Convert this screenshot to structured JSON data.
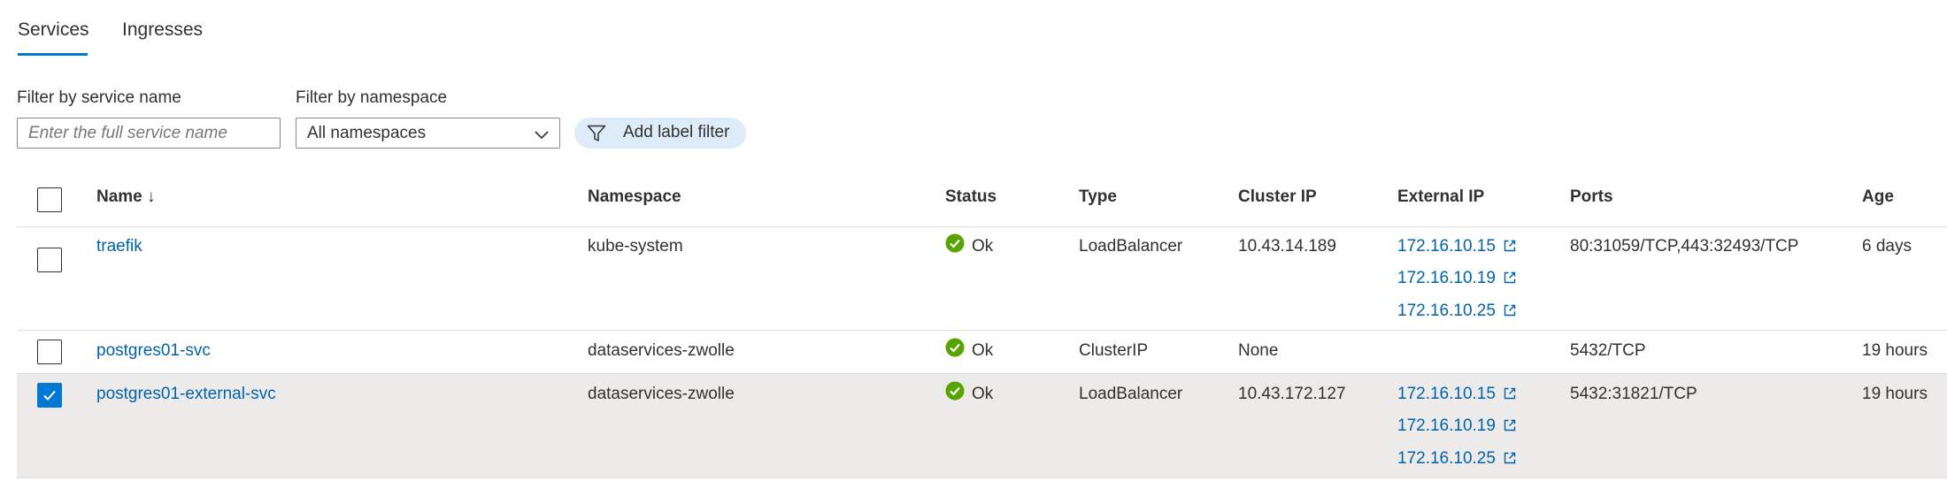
{
  "tabs": [
    {
      "label": "Services",
      "active": true
    },
    {
      "label": "Ingresses",
      "active": false
    }
  ],
  "filters": {
    "service_name_label": "Filter by service name",
    "service_name_placeholder": "Enter the full service name",
    "namespace_label": "Filter by namespace",
    "namespace_value": "All namespaces",
    "add_label_filter": "Add label filter"
  },
  "table": {
    "headers": {
      "name": "Name ↓",
      "namespace": "Namespace",
      "status": "Status",
      "type": "Type",
      "cluster_ip": "Cluster IP",
      "external_ip": "External IP",
      "ports": "Ports",
      "age": "Age"
    },
    "rows": [
      {
        "name": "traefik",
        "namespace": "kube-system",
        "status": "Ok",
        "type": "LoadBalancer",
        "cluster_ip": "10.43.14.189",
        "external_ips": [
          "172.16.10.15",
          "172.16.10.19",
          "172.16.10.25"
        ],
        "ports": "80:31059/TCP,443:32493/TCP",
        "age": "6 days",
        "selected": false
      },
      {
        "name": "postgres01-svc",
        "namespace": "dataservices-zwolle",
        "status": "Ok",
        "type": "ClusterIP",
        "cluster_ip": "None",
        "external_ips": [],
        "ports": "5432/TCP",
        "age": "19 hours",
        "selected": false
      },
      {
        "name": "postgres01-external-svc",
        "namespace": "dataservices-zwolle",
        "status": "Ok",
        "type": "LoadBalancer",
        "cluster_ip": "10.43.172.127",
        "external_ips": [
          "172.16.10.15",
          "172.16.10.19",
          "172.16.10.25"
        ],
        "ports": "5432:31821/TCP",
        "age": "19 hours",
        "selected": true
      }
    ]
  },
  "colors": {
    "accent": "#0078d4",
    "link": "#0062ad",
    "status_ok": "#57a300",
    "selected_row": "#edebe9",
    "label_filter_bg": "#deecf9"
  },
  "icons": {
    "status_ok": "check-circle-icon",
    "external_link": "open-in-new-window-icon",
    "filter": "funnel-icon",
    "dropdown": "chevron-down-icon"
  }
}
